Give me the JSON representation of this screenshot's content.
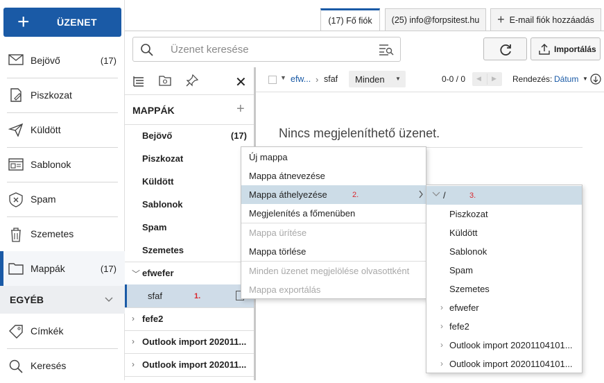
{
  "compose": {
    "plus": "+",
    "label": "ÜZENET"
  },
  "nav": {
    "items": [
      {
        "label": "Bejövő",
        "count": "(17)",
        "icon": "inbox-icon"
      },
      {
        "label": "Piszkozat",
        "count": "",
        "icon": "draft-icon"
      },
      {
        "label": "Küldött",
        "count": "",
        "icon": "sent-icon"
      },
      {
        "label": "Sablonok",
        "count": "",
        "icon": "template-icon"
      },
      {
        "label": "Spam",
        "count": "",
        "icon": "spam-icon"
      },
      {
        "label": "Szemetes",
        "count": "",
        "icon": "trash-icon"
      },
      {
        "label": "Mappák",
        "count": "(17)",
        "icon": "folder-icon"
      }
    ],
    "other_label": "EGYÉB",
    "other_items": [
      {
        "label": "Címkék",
        "icon": "tag-icon"
      },
      {
        "label": "Keresés",
        "icon": "search-icon"
      }
    ]
  },
  "tabs": [
    {
      "label": "(17) Fő fiók",
      "active": true
    },
    {
      "label": "(25) info@forpsitest.hu",
      "active": false
    },
    {
      "label": "E-mail fiók hozzáadás",
      "active": false
    }
  ],
  "tab_add_plus": "+",
  "search": {
    "placeholder": "Üzenet keresése"
  },
  "toolbar": {
    "import_label": "Importálás"
  },
  "folders": {
    "title": "MAPPÁK",
    "add": "+",
    "close": "✕",
    "items": [
      {
        "label": "Bejövő",
        "count": "(17)"
      },
      {
        "label": "Piszkozat",
        "count": ""
      },
      {
        "label": "Küldött",
        "count": ""
      },
      {
        "label": "Sablonok",
        "count": ""
      },
      {
        "label": "Spam",
        "count": ""
      },
      {
        "label": "Szemetes",
        "count": ""
      },
      {
        "label": "efwefer",
        "count": "",
        "chevron": "﹀"
      },
      {
        "label": "sfaf",
        "count": "",
        "annotation": "1."
      },
      {
        "label": "fefe2",
        "count": "",
        "chevron": "›"
      },
      {
        "label": "Outlook import 202011...",
        "count": "",
        "chevron": "›"
      },
      {
        "label": "Outlook import 202011...",
        "count": "",
        "chevron": "›"
      }
    ]
  },
  "list": {
    "crumb_parent": "efw...",
    "crumb_sep": "›",
    "crumb_current": "sfaf",
    "filter": "Minden",
    "count": "0-0 / 0",
    "sort_label": "Rendezés:",
    "sort_value": "Dátum",
    "empty_message": "Nincs megjeleníthető üzenet."
  },
  "context_menu": {
    "items": [
      {
        "label": "Új mappa",
        "disabled": false
      },
      {
        "label": "Mappa átnevezése",
        "disabled": false
      },
      {
        "label": "Mappa áthelyezése",
        "disabled": false,
        "annotation": "2."
      },
      {
        "label": "Megjelenítés a főmenüben",
        "disabled": false
      },
      {
        "label": "Mappa ürítése",
        "disabled": true
      },
      {
        "label": "Mappa törlése",
        "disabled": false
      },
      {
        "label": "Minden üzenet megjelölése olvasottként",
        "disabled": true
      },
      {
        "label": "Mappa exportálás",
        "disabled": true
      }
    ]
  },
  "submenu": {
    "root": "/",
    "root_annotation": "3.",
    "items": [
      {
        "label": "Piszkozat",
        "chevron": ""
      },
      {
        "label": "Küldött",
        "chevron": ""
      },
      {
        "label": "Sablonok",
        "chevron": ""
      },
      {
        "label": "Spam",
        "chevron": ""
      },
      {
        "label": "Szemetes",
        "chevron": ""
      },
      {
        "label": "efwefer",
        "chevron": "›"
      },
      {
        "label": "fefe2",
        "chevron": "›"
      },
      {
        "label": "Outlook import 20201104101...",
        "chevron": "›"
      },
      {
        "label": "Outlook import 20201104101...",
        "chevron": "›"
      }
    ]
  },
  "colors": {
    "accent": "#1a5aa6",
    "selected": "#cfdce8",
    "annotation": "#d9262c"
  }
}
